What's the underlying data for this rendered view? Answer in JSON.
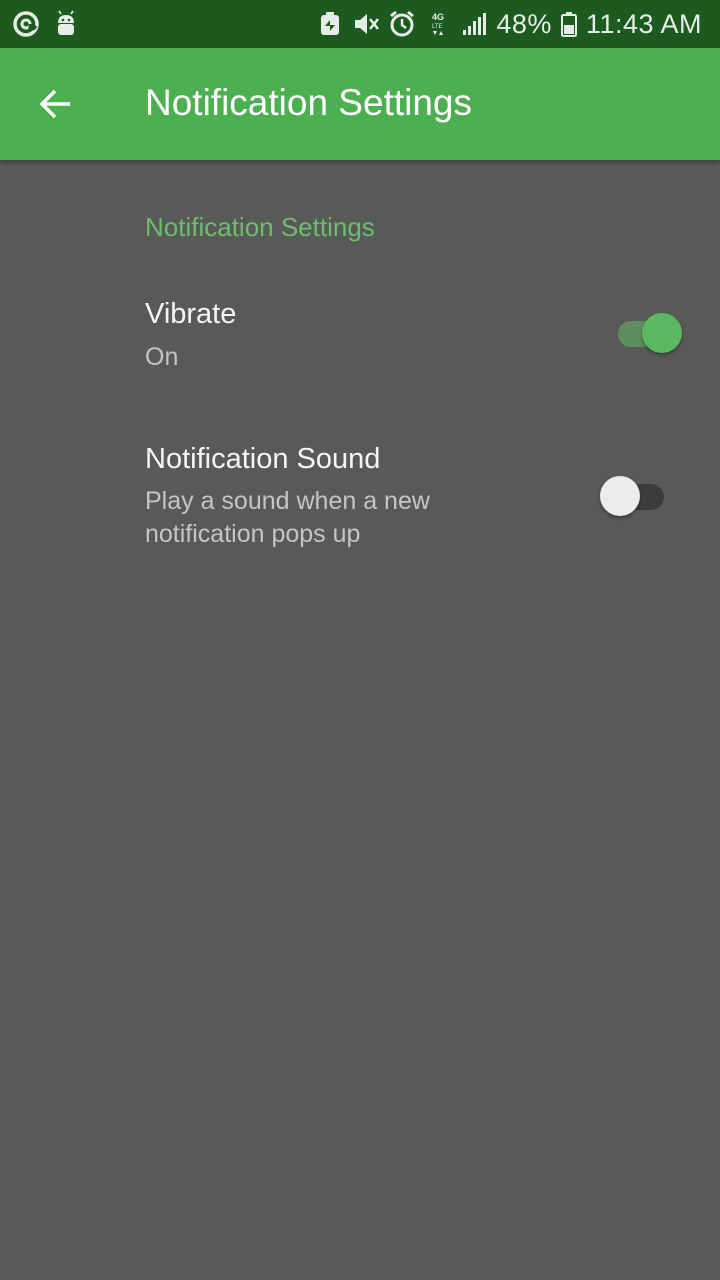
{
  "status_bar": {
    "left_icons": [
      "at-sign-icon",
      "android-icon"
    ],
    "right_icons": [
      "battery-saver-icon",
      "mute-icon",
      "alarm-icon",
      "lte-icon",
      "signal-icon"
    ],
    "battery_percent": "48%",
    "time": "11:43 AM"
  },
  "app_bar": {
    "back_icon": "arrow-back-icon",
    "title": "Notification Settings",
    "color": "#4caf50"
  },
  "settings": {
    "section_title": "Notification Settings",
    "vibrate": {
      "title": "Vibrate",
      "summary": "On",
      "enabled": true
    },
    "sound": {
      "title": "Notification Sound",
      "summary_line1": "Play a sound when a new",
      "summary_line2": "notification pops up",
      "enabled": false
    }
  },
  "colors": {
    "accent": "#6dbd6f",
    "background": "#585a58",
    "status_bar": "#1d5a1f"
  }
}
